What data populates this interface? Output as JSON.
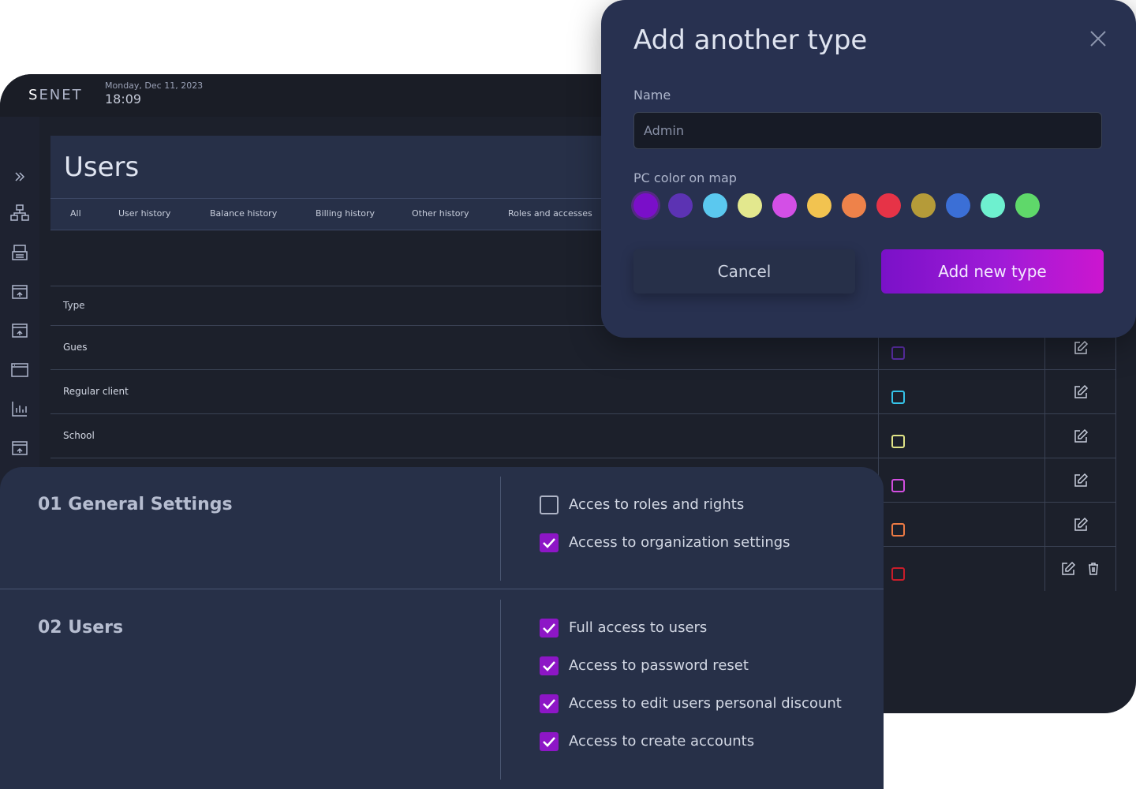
{
  "app": {
    "logo_s": "S",
    "logo_rest": "ENET",
    "date": "Monday, Dec 11, 2023",
    "time": "18:09"
  },
  "sidebar": {
    "icons": [
      "expand-icon",
      "network-icon",
      "printer-icon",
      "monitor-icon",
      "monitor-icon",
      "window-icon",
      "bar-chart-icon",
      "monitor-icon",
      "monitor-icon"
    ]
  },
  "main": {
    "title": "Users",
    "tabs": [
      "All",
      "User history",
      "Balance history",
      "Billing history",
      "Other history",
      "Roles and accesses"
    ],
    "table_header": "Type",
    "rows": [
      {
        "label": "Gues",
        "color": "#5b2fa6",
        "delete": false
      },
      {
        "label": "Regular client",
        "color": "#35c3e8",
        "delete": false
      },
      {
        "label": "School",
        "color": "#e0e487",
        "delete": false
      },
      {
        "label": "",
        "color": "#d24ee0",
        "delete": false
      },
      {
        "label": "",
        "color": "#ec7a44",
        "delete": false
      },
      {
        "label": "",
        "color": "#c91d2a",
        "delete": true
      }
    ]
  },
  "modal": {
    "title": "Add another type",
    "name_label": "Name",
    "name_placeholder": "Admin",
    "color_label": "PC color on map",
    "colors": [
      "#7a0fc9",
      "#5c33b3",
      "#5bc8ef",
      "#e3e88e",
      "#d34fe6",
      "#f2c350",
      "#ee824a",
      "#e63347",
      "#b59b39",
      "#3b6fd6",
      "#6ef0cf",
      "#5fd86a"
    ],
    "selected_color_index": 0,
    "cancel_label": "Cancel",
    "submit_label": "Add new type"
  },
  "permissions": {
    "sections": [
      {
        "title": "01 General Settings",
        "items": [
          {
            "label": "Acces to roles and rights",
            "checked": false
          },
          {
            "label": "Access to organization settings",
            "checked": true
          }
        ]
      },
      {
        "title": "02 Users",
        "items": [
          {
            "label": "Full access to users",
            "checked": true
          },
          {
            "label": "Access to password reset",
            "checked": true
          },
          {
            "label": "Access to edit users personal discount",
            "checked": true
          },
          {
            "label": "Access to create accounts",
            "checked": true
          }
        ]
      }
    ]
  }
}
